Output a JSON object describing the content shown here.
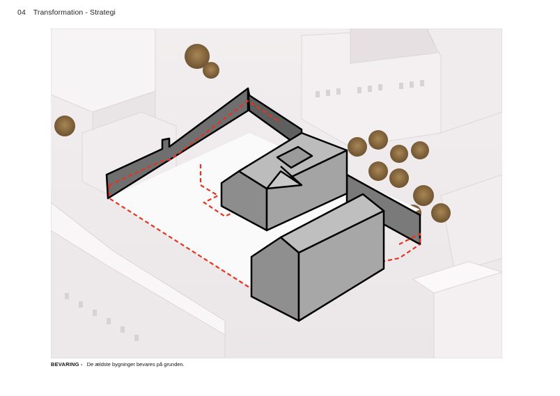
{
  "header": {
    "number": "04",
    "title": "Transformation - Strategi"
  },
  "caption": {
    "label": "BEVARING -",
    "text": "De ældste bygninger bevares på grunden."
  },
  "colors": {
    "accent_red": "#e8321e",
    "wall_dark": "#7a7a7a",
    "roof_grey": "#a9a9a9",
    "context_white": "#f3eff0",
    "tree_brown": "#8a6a3e"
  }
}
